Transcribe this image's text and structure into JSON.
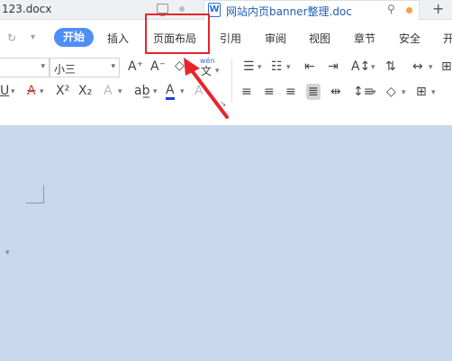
{
  "tabs": {
    "tab1_title": "123.docx",
    "tab2_icon": "W",
    "tab2_title": "网站内页banner整理.doc",
    "pin_icon": "pin-icon",
    "new_tab": "+"
  },
  "menubar": {
    "start": "开始",
    "items": [
      "插入",
      "页面布局",
      "引用",
      "审阅",
      "视图",
      "章节",
      "安全",
      "开"
    ]
  },
  "toolbar": {
    "font_size": "小三",
    "pinyin_top": "wén",
    "pinyin_bottom": "文"
  },
  "highlight_color": "#e8242a",
  "accent_color": "#4e8ef7"
}
